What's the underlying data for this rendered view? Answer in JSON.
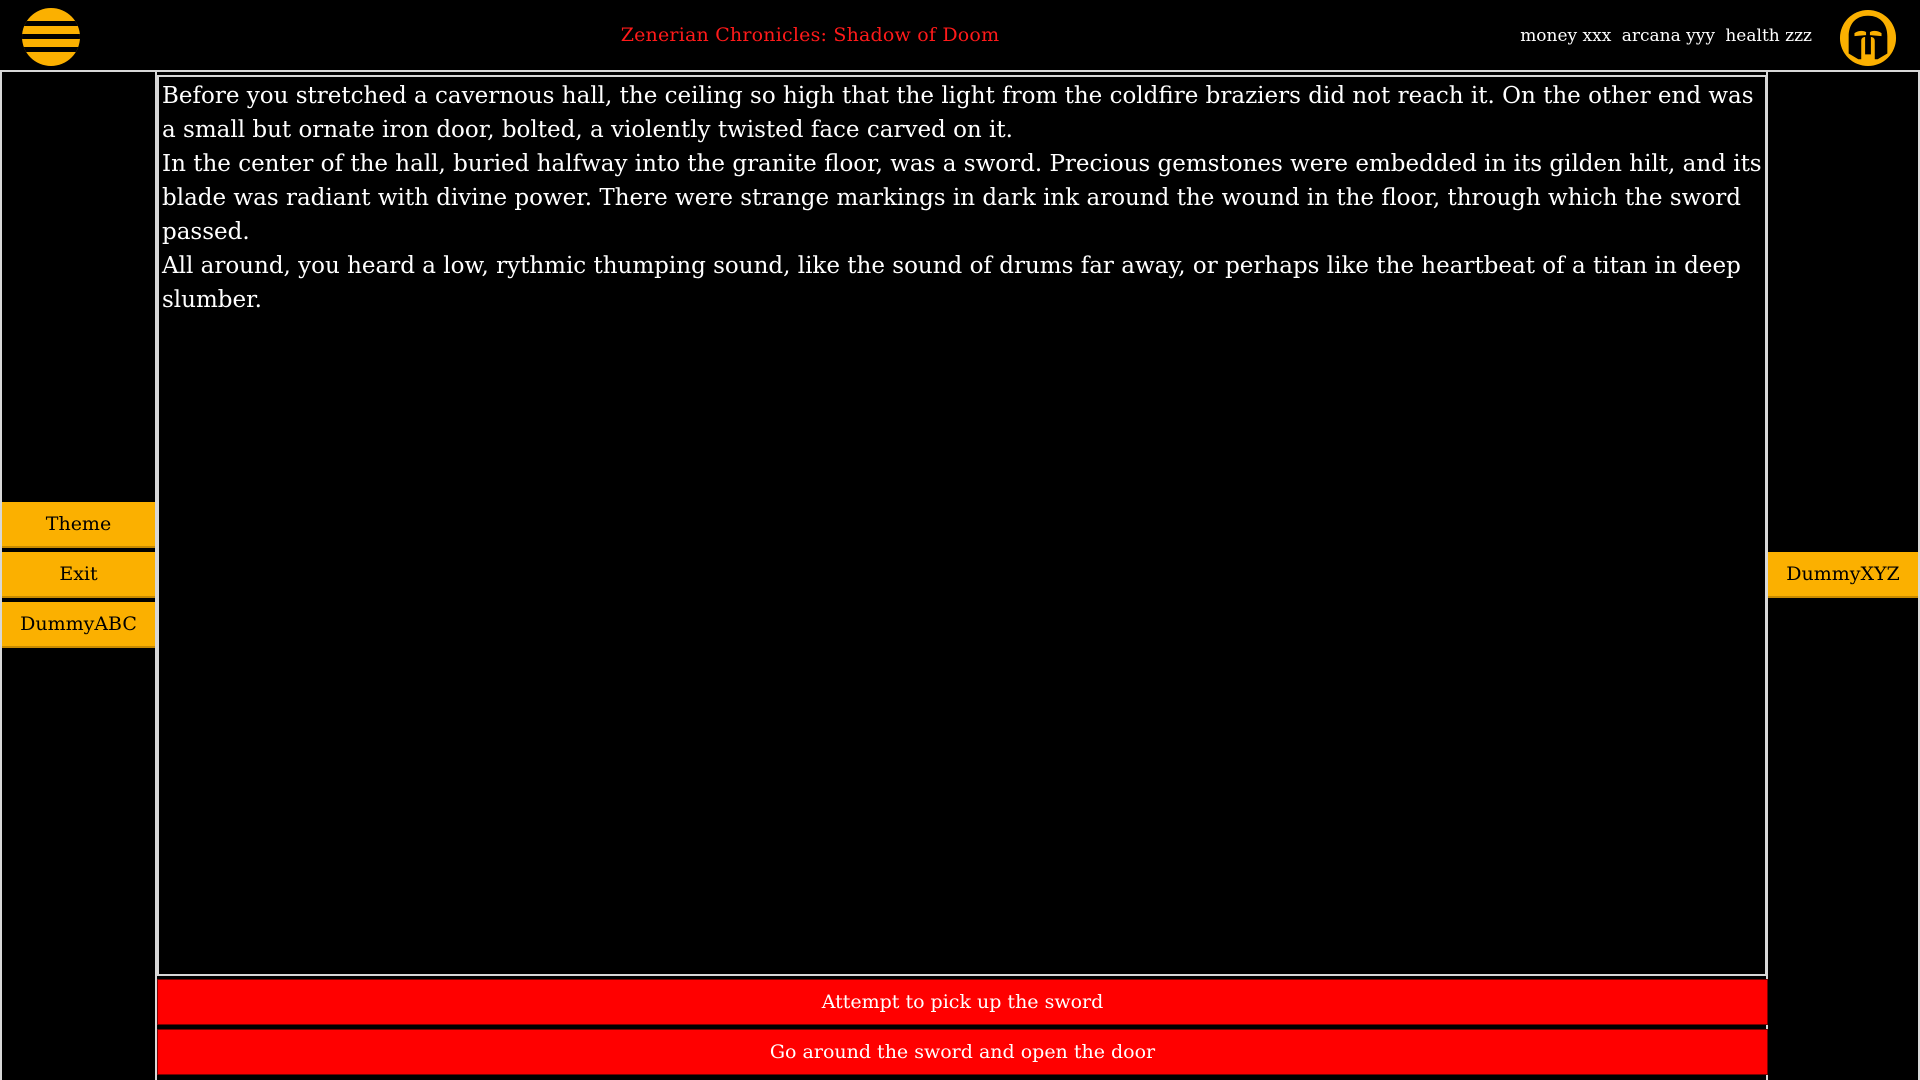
{
  "header": {
    "title": "Zenerian Chronicles: Shadow of Doom",
    "stats": {
      "money": "money xxx",
      "arcana": "arcana yyy",
      "health": "health zzz"
    },
    "menu_icon": "hamburger-menu-icon",
    "profile_icon": "spartan-helmet-icon"
  },
  "left_menu": {
    "items": [
      {
        "label": "Theme"
      },
      {
        "label": "Exit"
      },
      {
        "label": "DummyABC"
      }
    ]
  },
  "right_menu": {
    "items": [
      {
        "label": "DummyXYZ"
      }
    ]
  },
  "story": {
    "paragraphs": [
      "Before you stretched a cavernous hall, the ceiling so high that the light from the coldfire braziers did not reach it. On the other end was a small but ornate iron door, bolted, a violently twisted face carved on it.",
      "In the center of the hall, buried halfway into the granite floor, was a sword. Precious gemstones were embedded in its gilden hilt, and its blade was radiant with divine power. There were strange markings in dark ink around the wound in the floor, through which the sword passed.",
      "All around, you heard a low, rythmic thumping sound, like the sound of drums far away, or perhaps like the heartbeat of a titan in deep slumber."
    ]
  },
  "choices": [
    {
      "label": "Attempt to pick up the sword"
    },
    {
      "label": "Go around the sword and open the door"
    }
  ],
  "colors": {
    "accent": "#fbb000",
    "title": "#ff1a1a",
    "choice_bg": "#ff0000",
    "background": "#000000",
    "text": "#ffffff"
  }
}
